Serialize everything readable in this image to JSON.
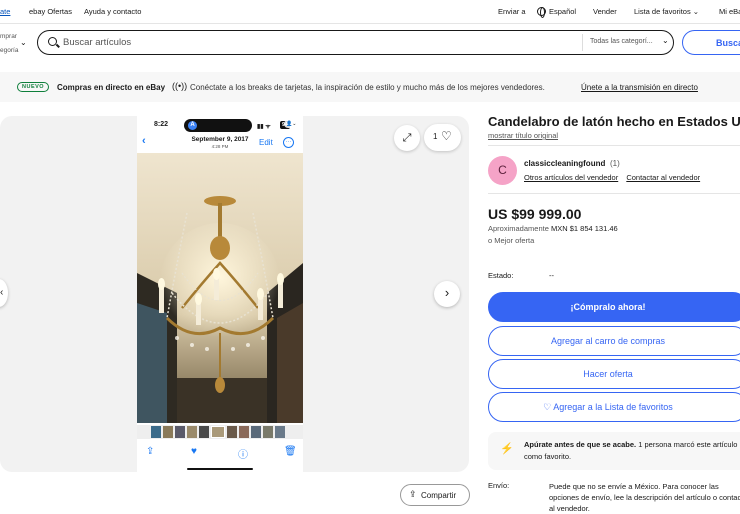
{
  "topbar": {
    "left_link": "ate",
    "ebay_offers": "ebay Ofertas",
    "help": "Ayuda y contacto",
    "ship_to": "Enviar a",
    "language": "Español",
    "sell": "Vender",
    "watchlist": "Lista de favoritos",
    "my_ebay": "Mi eBay"
  },
  "search": {
    "category_line1": "mprar",
    "category_line2": "egoría",
    "placeholder": "Buscar artículos",
    "category_select": "Todas las categorí...",
    "button": "Busca"
  },
  "banner": {
    "badge": "NUEVO",
    "title": "Compras en directo en eBay",
    "text": "Conéctate a los breaks de tarjetas, la inspiración de estilo y mucho más de los mejores vendedores.",
    "link": "Únete a la transmisión en directo"
  },
  "gallery": {
    "watch_count": "1",
    "phone": {
      "time": "8:22",
      "island_letter": "A",
      "battery": "94",
      "date": "September 9, 2017",
      "subdate": "4:28 PM",
      "edit": "Edit"
    }
  },
  "item": {
    "title": "Candelabro de latón hecho en Estados Unidos",
    "original_title_link": "mostrar título original",
    "seller_initial": "C",
    "seller_name": "classiccleaningfound",
    "seller_feedback": "(1)",
    "seller_other_items": "Otros artículos del vendedor",
    "contact_seller": "Contactar al vendedor",
    "price": "US $99 999.00",
    "approx_label": "Aproximadamente",
    "approx_value": "MXN $1 854 131.46",
    "best_offer": "o Mejor oferta",
    "condition_label": "Estado:",
    "condition_value": "--",
    "buy_now": "¡Cómpralo ahora!",
    "add_to_cart": "Agregar al carro de compras",
    "make_offer": "Hacer oferta",
    "add_watchlist": "♡ Agregar a la Lista de favoritos",
    "alert_bold": "Apúrate antes de que se acabe.",
    "alert_text": " 1 persona marcó este artículo como favorito.",
    "shipping_label": "Envío:",
    "shipping_text": "Puede que no se envíe a México. Para conocer las opciones de envío, lee la descripción del artículo o contacta al vendedor.",
    "share": "Compartir"
  }
}
